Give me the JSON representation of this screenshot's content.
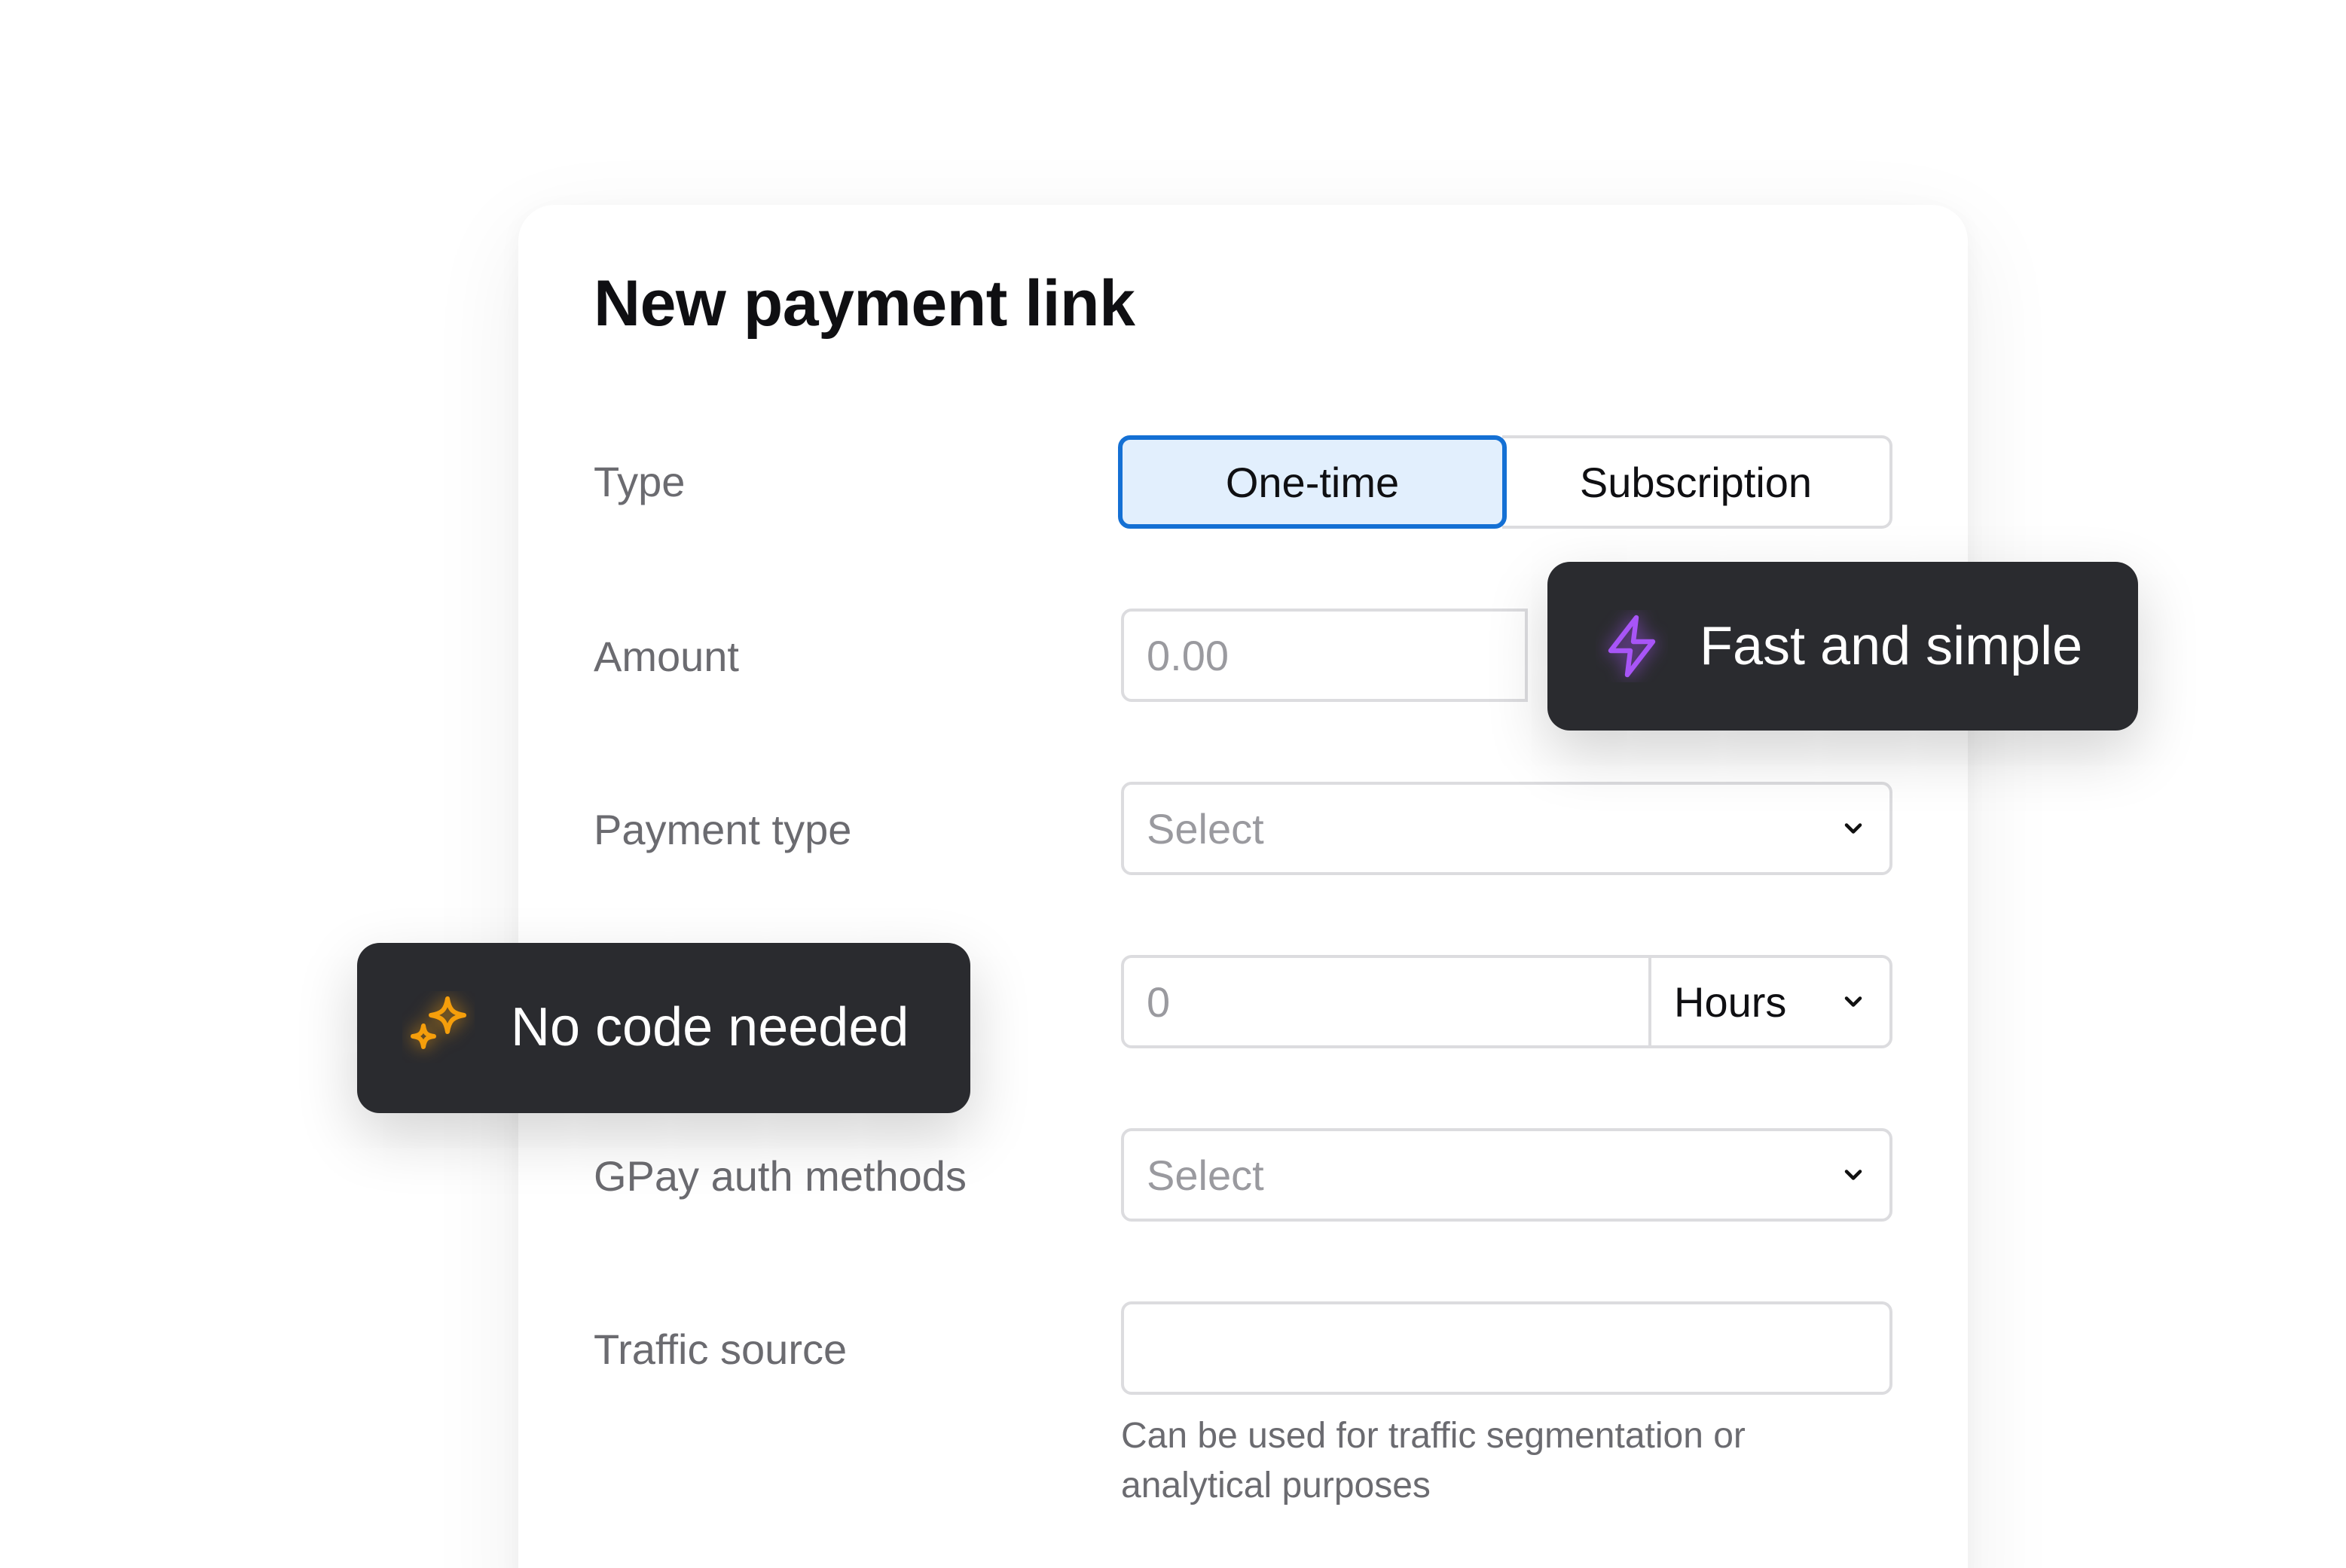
{
  "form": {
    "title": "New payment link",
    "type": {
      "label": "Type",
      "options": [
        "One-time",
        "Subscription"
      ],
      "selected": "One-time"
    },
    "amount": {
      "label": "Amount",
      "placeholder": "0.00"
    },
    "payment_type": {
      "label": "Payment type",
      "placeholder": "Select"
    },
    "duration": {
      "value_placeholder": "0",
      "unit": "Hours"
    },
    "gpay_auth_methods": {
      "label": "GPay auth methods",
      "placeholder": "Select"
    },
    "traffic_source": {
      "label": "Traffic source",
      "value": "",
      "helper": "Can be used for traffic segmentation or analytical purposes"
    }
  },
  "callouts": {
    "fast": {
      "text": "Fast and simple",
      "icon": "lightning-icon",
      "color": "#a855f7"
    },
    "nocode": {
      "text": "No code needed",
      "icon": "sparkles-icon",
      "color": "#f59e0b"
    }
  },
  "colors": {
    "accent": "#1470d4",
    "accent_bg": "#e2effd",
    "pill_bg": "#2a2b2f"
  }
}
